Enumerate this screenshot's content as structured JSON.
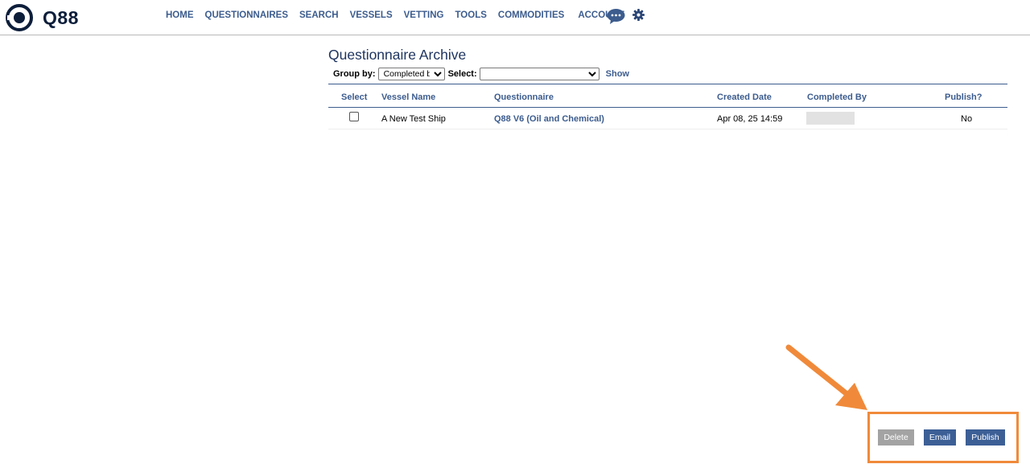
{
  "header": {
    "logo_text": "Q88",
    "nav": [
      "HOME",
      "QUESTIONNAIRES",
      "SEARCH",
      "VESSELS",
      "VETTING",
      "TOOLS",
      "COMMODITIES",
      "ACCOUNT"
    ]
  },
  "page": {
    "title": "Questionnaire Archive",
    "group_by_label": "Group by:",
    "group_by_value": "Completed by",
    "select_label": "Select:",
    "select_value": "",
    "show_label": "Show"
  },
  "table": {
    "columns": [
      "Select",
      "Vessel Name",
      "Questionnaire",
      "Created Date",
      "Completed By",
      "Publish?"
    ],
    "rows": [
      {
        "selected": false,
        "vessel_name": "A New Test Ship",
        "questionnaire": "Q88 V6 (Oil and Chemical)",
        "created_date": "Apr 08, 25 14:59",
        "completed_by": "",
        "publish": "No"
      }
    ]
  },
  "actions": {
    "delete": "Delete",
    "email": "Email",
    "publish": "Publish"
  },
  "colors": {
    "brand_navy": "#0d1e3b",
    "link_blue": "#3c5c8e",
    "button_blue": "#3c5f96",
    "button_disabled": "#a3a3a3",
    "annotation_orange": "#f08a3a"
  },
  "icons": [
    "q88-logo-icon",
    "chat-bubble-icon",
    "gear-icon"
  ]
}
